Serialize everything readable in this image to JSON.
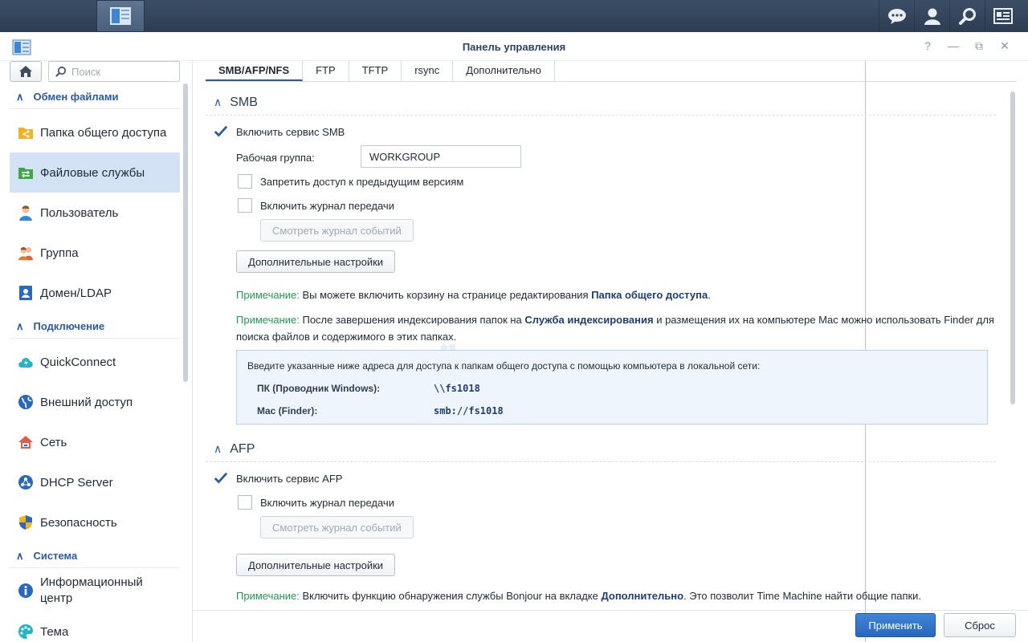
{
  "window": {
    "title": "Панель управления",
    "controls": [
      "?",
      "—",
      "⧉",
      "✕"
    ]
  },
  "taskbar": {
    "icons": [
      "main-menu-icon",
      "control-panel-app-icon",
      "chat-icon",
      "user-icon",
      "search-icon",
      "widgets-icon"
    ]
  },
  "sidebar": {
    "search_placeholder": "Поиск",
    "sections": [
      {
        "title": "Обмен файлами"
      },
      {
        "title": "Подключение"
      },
      {
        "title": "Система"
      }
    ],
    "items": [
      {
        "label": "Папка общего доступа",
        "icon": "shared-folder-icon"
      },
      {
        "label": "Файловые службы",
        "icon": "file-services-icon"
      },
      {
        "label": "Пользователь",
        "icon": "user-icon"
      },
      {
        "label": "Группа",
        "icon": "group-icon"
      },
      {
        "label": "Домен/LDAP",
        "icon": "domain-icon"
      },
      {
        "label": "QuickConnect",
        "icon": "quickconnect-icon"
      },
      {
        "label": "Внешний доступ",
        "icon": "external-access-icon"
      },
      {
        "label": "Сеть",
        "icon": "network-icon"
      },
      {
        "label": "DHCP Server",
        "icon": "dhcp-icon"
      },
      {
        "label": "Безопасность",
        "icon": "security-shield-icon"
      },
      {
        "label": "Информационный центр",
        "icon": "info-icon"
      },
      {
        "label": "Тема",
        "icon": "theme-palette-icon"
      }
    ]
  },
  "tabs": [
    "SMB/AFP/NFS",
    "FTP",
    "TFTP",
    "rsync",
    "Дополнительно"
  ],
  "smb": {
    "title": "SMB",
    "enable_label": "Включить сервис SMB",
    "workgroup_label": "Рабочая группа:",
    "workgroup_value": "WORKGROUP",
    "deny_prev_label": "Запретить доступ к предыдущим версиям",
    "transfer_log_label": "Включить журнал передачи",
    "view_log_button": "Смотреть журнал событий",
    "advanced_button": "Дополнительные настройки",
    "note1_prefix": "Примечание:",
    "note1_text": " Вы можете включить корзину на странице редактирования ",
    "note1_link": "Папка общего доступа",
    "note1_end": ".",
    "note2_prefix": "Примечание:",
    "note2_text": " После завершения индексирования папок на ",
    "note2_link": "Служба индексирования",
    "note2_end": " и размещения их на компьютере Mac можно использовать Finder для поиска файлов и содержимого в этих папках.",
    "info_intro": "Введите указанные ниже адреса для доступа к папкам общего доступа с помощью компьютера в локальной сети:",
    "info_pc_label": "ПК (Проводник Windows):",
    "info_pc_value": "\\\\fs1018",
    "info_mac_label": "Mac (Finder):",
    "info_mac_value": "smb://fs1018"
  },
  "afp": {
    "title": "AFP",
    "enable_label": "Включить сервис AFP",
    "transfer_log_label": "Включить журнал передачи",
    "view_log_button": "Смотреть журнал событий",
    "advanced_button": "Дополнительные настройки",
    "note_prefix": "Примечание:",
    "note_text": " Включить функцию обнаружения службы Bonjour на вкладке ",
    "note_link": "Дополнительно",
    "note_end": ". Это позволит Time Machine найти общие папки."
  },
  "footer": {
    "apply_button": "Применить",
    "reset_button": "Сброс"
  }
}
